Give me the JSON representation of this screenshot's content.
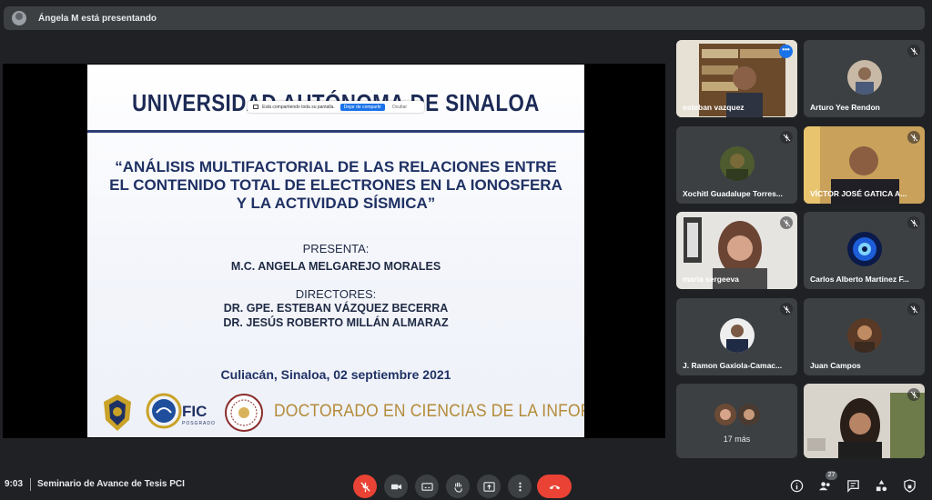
{
  "banner": {
    "text": "Ángela M está presentando"
  },
  "slide": {
    "university": "UNIVERSIDAD AUTÓNOMA DE SINALOA",
    "share_notice": "Está compartiendo toda su pantalla.",
    "stop_share": "Dejar de compartir",
    "hide": "Ocultar",
    "title": "“ANÁLISIS MULTIFACTORIAL DE LAS RELACIONES ENTRE EL CONTENIDO TOTAL DE ELECTRONES EN LA IONOSFERA Y LA ACTIVIDAD SÍSMICA”",
    "presenta_label": "PRESENTA:",
    "presenter": "M.C. ANGELA MELGAREJO MORALES",
    "directores_label": "DIRECTORES:",
    "director1": "DR.  GPE. ESTEBAN VÁZQUEZ BECERRA",
    "director2": "DR.  JESÚS ROBERTO MILLÁN ALMARAZ",
    "place_date": "Culiacán, Sinaloa, 02 septiembre 2021",
    "fic": "FIC",
    "fic_sub": "POSGRADO",
    "program": "DOCTORADO EN CIENCIAS DE LA INFORMACIÓN"
  },
  "participants": [
    {
      "name": "esteban vazquez"
    },
    {
      "name": "Arturo Yee Rendon"
    },
    {
      "name": "Xochitl Guadalupe Torres..."
    },
    {
      "name": "VÍCTOR JOSÉ GATICA A..."
    },
    {
      "name": "maria sergeeva"
    },
    {
      "name": "Carlos Alberto Martínez F..."
    },
    {
      "name": "J. Ramon Gaxiola-Camac..."
    },
    {
      "name": "Juan Campos"
    },
    {
      "name": "17 más"
    },
    {
      "name": ""
    }
  ],
  "bottom": {
    "time": "9:03",
    "meeting": "Seminario de Avance de Tesis PCI",
    "people_count": "27"
  },
  "colors": {
    "end_call": "#ea4335",
    "accent": "#1a73e8",
    "selected": "#8ab4f8"
  }
}
